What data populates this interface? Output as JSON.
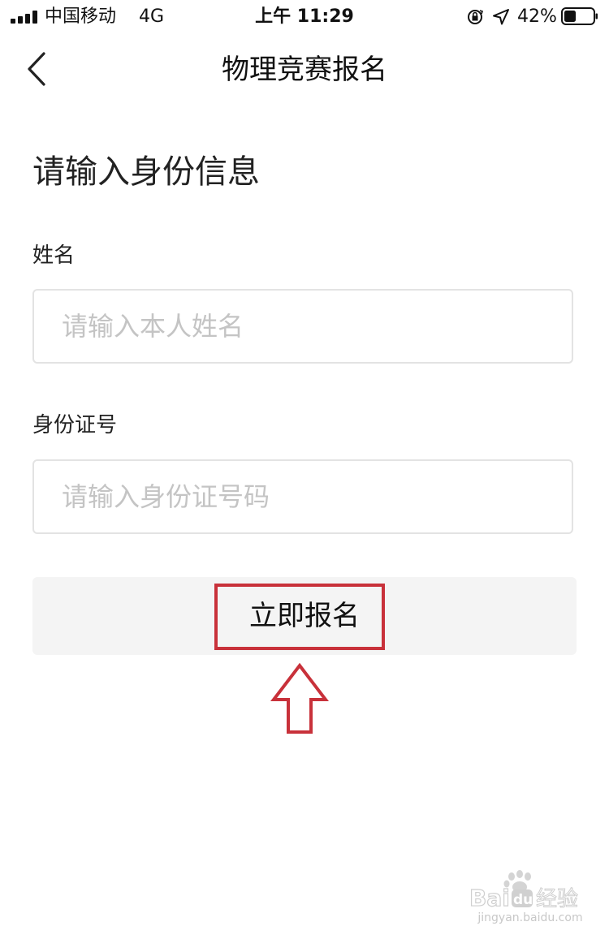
{
  "status_bar": {
    "carrier": "中国移动",
    "network": "4G",
    "time": "上午 11:29",
    "battery_percent": "42%",
    "battery_level": 0.42,
    "icons": [
      "signal-icon",
      "orientation-lock-icon",
      "location-icon",
      "battery-icon"
    ]
  },
  "nav": {
    "title": "物理竞赛报名",
    "back_icon": "chevron-left-icon"
  },
  "form": {
    "heading": "请输入身份信息",
    "name_label": "姓名",
    "name_value": "",
    "name_placeholder": "请输入本人姓名",
    "id_label": "身份证号",
    "id_value": "",
    "id_placeholder": "请输入身份证号码",
    "submit_label": "立即报名"
  },
  "annotation": {
    "highlight_color": "#c8313a",
    "arrow_icon": "up-arrow-icon"
  },
  "watermark": {
    "brand": "Baidu经验",
    "url": "jingyan.baidu.com"
  },
  "colors": {
    "placeholder": "#c4c4c4",
    "input_border": "#e3e3e3",
    "button_bg": "#f4f4f4",
    "text": "#111111"
  }
}
